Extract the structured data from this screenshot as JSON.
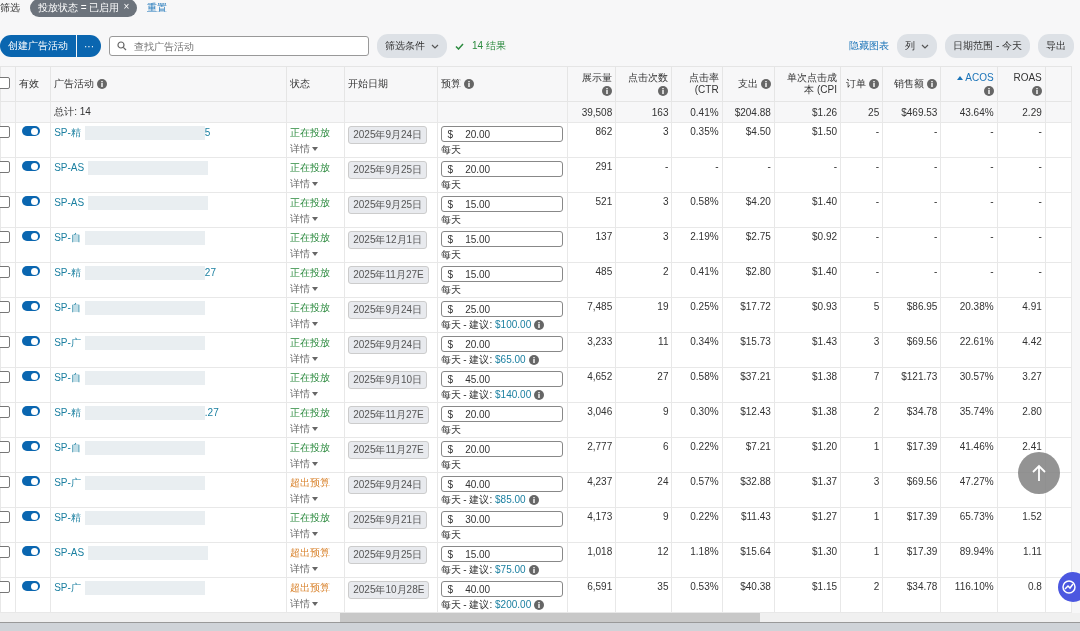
{
  "filter_bar": {
    "label": "筛选",
    "chip": "投放状态 = 已启用",
    "chip_close": "×",
    "reset": "重置"
  },
  "toolbar": {
    "create": "创建广告活动",
    "more": "···",
    "search_placeholder": "查找广告活动",
    "filter": "筛选条件",
    "result": "14 结果",
    "hide_chart": "隐藏图表",
    "columns": "列",
    "date_range": "日期范围 - 今天",
    "export": "导出"
  },
  "select_all_checked": false,
  "columns": [
    {
      "label": "有效",
      "info": false,
      "sorted": false
    },
    {
      "label": "广告活动",
      "info": true,
      "sorted": false
    },
    {
      "label": "状态",
      "info": false,
      "sorted": false
    },
    {
      "label": "开始日期",
      "info": false,
      "sorted": false
    },
    {
      "label": "预算",
      "info": true,
      "sorted": false
    },
    {
      "label": "展示量",
      "info": true,
      "sorted": false
    },
    {
      "label": "点击次数",
      "info": true,
      "sorted": false
    },
    {
      "label": "点击率 (CTR",
      "info": false,
      "sorted": false
    },
    {
      "label": "支出",
      "info": true,
      "sorted": false
    },
    {
      "label": "单次点击成本 (CPI",
      "info": false,
      "sorted": false
    },
    {
      "label": "订单",
      "info": true,
      "sorted": false
    },
    {
      "label": "销售额",
      "info": true,
      "sorted": false
    },
    {
      "label": "ACOS",
      "info": true,
      "sorted": true
    },
    {
      "label": "ROAS",
      "info": true,
      "sorted": false
    }
  ],
  "total": {
    "label": "总计: 14",
    "values": [
      "39,508",
      "163",
      "0.41%",
      "$204.88",
      "$1.26",
      "25",
      "$469.53",
      "43.64%",
      "2.29"
    ]
  },
  "rows": [
    {
      "checked": false,
      "enabled": true,
      "name": "SP-精",
      "tail": "5",
      "status": "正在投放",
      "over_budget": false,
      "details": "详情",
      "date": "2025年9月24日",
      "currency": "$",
      "budget": "20.00",
      "period": "每天",
      "values": [
        "862",
        "3",
        "0.35%",
        "$4.50",
        "$1.50",
        "-",
        "-",
        "-",
        "-"
      ]
    },
    {
      "checked": false,
      "enabled": true,
      "name": "SP-AS",
      "status": "正在投放",
      "over_budget": false,
      "details": "详情",
      "date": "2025年9月25日",
      "currency": "$",
      "budget": "20.00",
      "period": "每天",
      "values": [
        "291",
        "-",
        "-",
        "-",
        "-",
        "-",
        "-",
        "-",
        "-"
      ]
    },
    {
      "checked": false,
      "enabled": true,
      "name": "SP-AS",
      "status": "正在投放",
      "over_budget": false,
      "details": "详情",
      "date": "2025年9月25日",
      "currency": "$",
      "budget": "15.00",
      "period": "每天",
      "values": [
        "521",
        "3",
        "0.58%",
        "$4.20",
        "$1.40",
        "-",
        "-",
        "-",
        "-"
      ]
    },
    {
      "checked": false,
      "enabled": true,
      "name": "SP-自",
      "status": "正在投放",
      "over_budget": false,
      "details": "详情",
      "date": "2025年12月1日",
      "currency": "$",
      "budget": "15.00",
      "period": "每天",
      "values": [
        "137",
        "3",
        "2.19%",
        "$2.75",
        "$0.92",
        "-",
        "-",
        "-",
        "-"
      ]
    },
    {
      "checked": false,
      "enabled": true,
      "name": "SP-精",
      "tail": "27",
      "status": "正在投放",
      "over_budget": false,
      "details": "详情",
      "date": "2025年11月27E",
      "currency": "$",
      "budget": "15.00",
      "period": "每天",
      "values": [
        "485",
        "2",
        "0.41%",
        "$2.80",
        "$1.40",
        "-",
        "-",
        "-",
        "-"
      ]
    },
    {
      "checked": false,
      "enabled": true,
      "name": "SP-自",
      "status": "正在投放",
      "over_budget": false,
      "details": "详情",
      "date": "2025年9月24日",
      "currency": "$",
      "budget": "25.00",
      "period": "每天 - 建议:",
      "suggestion": "$100.00",
      "values": [
        "7,485",
        "19",
        "0.25%",
        "$17.72",
        "$0.93",
        "5",
        "$86.95",
        "20.38%",
        "4.91"
      ]
    },
    {
      "checked": false,
      "enabled": true,
      "name": "SP-广",
      "status": "正在投放",
      "over_budget": false,
      "details": "详情",
      "date": "2025年9月24日",
      "currency": "$",
      "budget": "20.00",
      "period": "每天 - 建议:",
      "suggestion": "$65.00",
      "values": [
        "3,233",
        "11",
        "0.34%",
        "$15.73",
        "$1.43",
        "3",
        "$69.56",
        "22.61%",
        "4.42"
      ]
    },
    {
      "checked": false,
      "enabled": true,
      "name": "SP-自",
      "status": "正在投放",
      "over_budget": false,
      "details": "详情",
      "date": "2025年9月10日",
      "currency": "$",
      "budget": "45.00",
      "period": "每天 - 建议:",
      "suggestion": "$140.00",
      "values": [
        "4,652",
        "27",
        "0.58%",
        "$37.21",
        "$1.38",
        "7",
        "$121.73",
        "30.57%",
        "3.27"
      ]
    },
    {
      "checked": false,
      "enabled": true,
      "name": "SP-精",
      "tail": ".27",
      "status": "正在投放",
      "over_budget": false,
      "details": "详情",
      "date": "2025年11月27E",
      "currency": "$",
      "budget": "20.00",
      "period": "每天",
      "values": [
        "3,046",
        "9",
        "0.30%",
        "$12.43",
        "$1.38",
        "2",
        "$34.78",
        "35.74%",
        "2.80"
      ]
    },
    {
      "checked": false,
      "enabled": true,
      "name": "SP-自",
      "status": "正在投放",
      "over_budget": false,
      "details": "详情",
      "date": "2025年11月27E",
      "currency": "$",
      "budget": "20.00",
      "period": "每天",
      "values": [
        "2,777",
        "6",
        "0.22%",
        "$7.21",
        "$1.20",
        "1",
        "$17.39",
        "41.46%",
        "2.41"
      ]
    },
    {
      "checked": false,
      "enabled": true,
      "name": "SP-广",
      "status": "超出预算",
      "over_budget": true,
      "details": "详情",
      "date": "2025年9月24日",
      "currency": "$",
      "budget": "40.00",
      "period": "每天 - 建议:",
      "suggestion": "$85.00",
      "values": [
        "4,237",
        "24",
        "0.57%",
        "$32.88",
        "$1.37",
        "3",
        "$69.56",
        "47.27%"
      ]
    },
    {
      "checked": false,
      "enabled": true,
      "name": "SP-精",
      "status": "正在投放",
      "over_budget": false,
      "details": "详情",
      "date": "2025年9月21日",
      "currency": "$",
      "budget": "30.00",
      "period": "每天",
      "values": [
        "4,173",
        "9",
        "0.22%",
        "$11.43",
        "$1.27",
        "1",
        "$17.39",
        "65.73%",
        "1.52"
      ]
    },
    {
      "checked": false,
      "enabled": true,
      "name": "SP-AS",
      "status": "超出预算",
      "over_budget": true,
      "details": "详情",
      "date": "2025年9月25日",
      "currency": "$",
      "budget": "15.00",
      "period": "每天 - 建议:",
      "suggestion": "$75.00",
      "values": [
        "1,018",
        "12",
        "1.18%",
        "$15.64",
        "$1.30",
        "1",
        "$17.39",
        "89.94%",
        "1.11"
      ]
    },
    {
      "checked": false,
      "enabled": true,
      "name": "SP-广",
      "status": "超出预算",
      "over_budget": true,
      "details": "详情",
      "date": "2025年10月28E",
      "currency": "$",
      "budget": "40.00",
      "period": "每天 - 建议:",
      "suggestion": "$200.00",
      "values": [
        "6,591",
        "35",
        "0.53%",
        "$40.38",
        "$1.15",
        "2",
        "$34.78",
        "116.10%",
        "0.8"
      ]
    }
  ]
}
